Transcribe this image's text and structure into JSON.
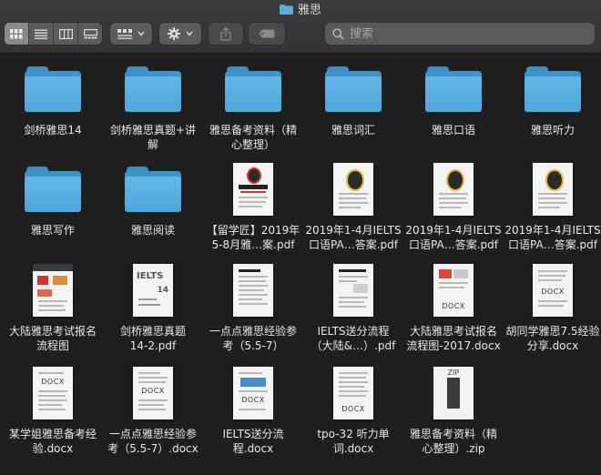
{
  "window": {
    "title": "雅思"
  },
  "toolbar": {
    "search_placeholder": "搜索"
  },
  "items": [
    {
      "label1": "剑桥雅思14",
      "label2": ""
    },
    {
      "label1": "剑桥雅思真题+讲",
      "label2": "解"
    },
    {
      "label1": "雅思备考资料（精",
      "label2": "心整理）"
    },
    {
      "label1": "雅思词汇",
      "label2": ""
    },
    {
      "label1": "雅思口语",
      "label2": ""
    },
    {
      "label1": "雅思听力",
      "label2": ""
    },
    {
      "label1": "雅思写作",
      "label2": ""
    },
    {
      "label1": "雅思阅读",
      "label2": ""
    },
    {
      "label1": "【留学匠】2019年",
      "label2": "5-8月雅…案.pdf"
    },
    {
      "label1": "2019年1-4月IELTS",
      "label2": "口语PA…答案.pdf"
    },
    {
      "label1": "2019年1-4月IELTS",
      "label2": "口语PA…答案.pdf"
    },
    {
      "label1": "2019年1-4月IELTS",
      "label2": "口语PA…答案.pdf"
    },
    {
      "label1": "大陆雅思考试报名",
      "label2": "流程图"
    },
    {
      "label1": "剑桥雅思真题",
      "label2": "14-2.pdf"
    },
    {
      "label1": "一点点雅思经验参",
      "label2": "考（5.5-7）"
    },
    {
      "label1": "IELTS送分流程",
      "label2": "（大陆&…）.pdf"
    },
    {
      "label1": "大陆雅思考试报名",
      "label2": "流程图-2017.docx"
    },
    {
      "label1": "胡同学雅思7.5经验",
      "label2": "分享.docx"
    },
    {
      "label1": "某学姐雅思备考经",
      "label2": "验.docx"
    },
    {
      "label1": "一点点雅思经验参",
      "label2": "考（5.5-7）.docx"
    },
    {
      "label1": "IELTS送分流",
      "label2": "程.docx"
    },
    {
      "label1": "tpo-32 听力单",
      "label2": "词.docx"
    },
    {
      "label1": "雅思备考资料（精",
      "label2": "心整理）.zip"
    }
  ],
  "thumb_text": {
    "docx": "DOCX",
    "zip": "ZIP",
    "ielts": "IELTS",
    "num14": "14"
  },
  "colors": {
    "folder_blue": "#4ea6da",
    "background": "#1e1e1e"
  }
}
